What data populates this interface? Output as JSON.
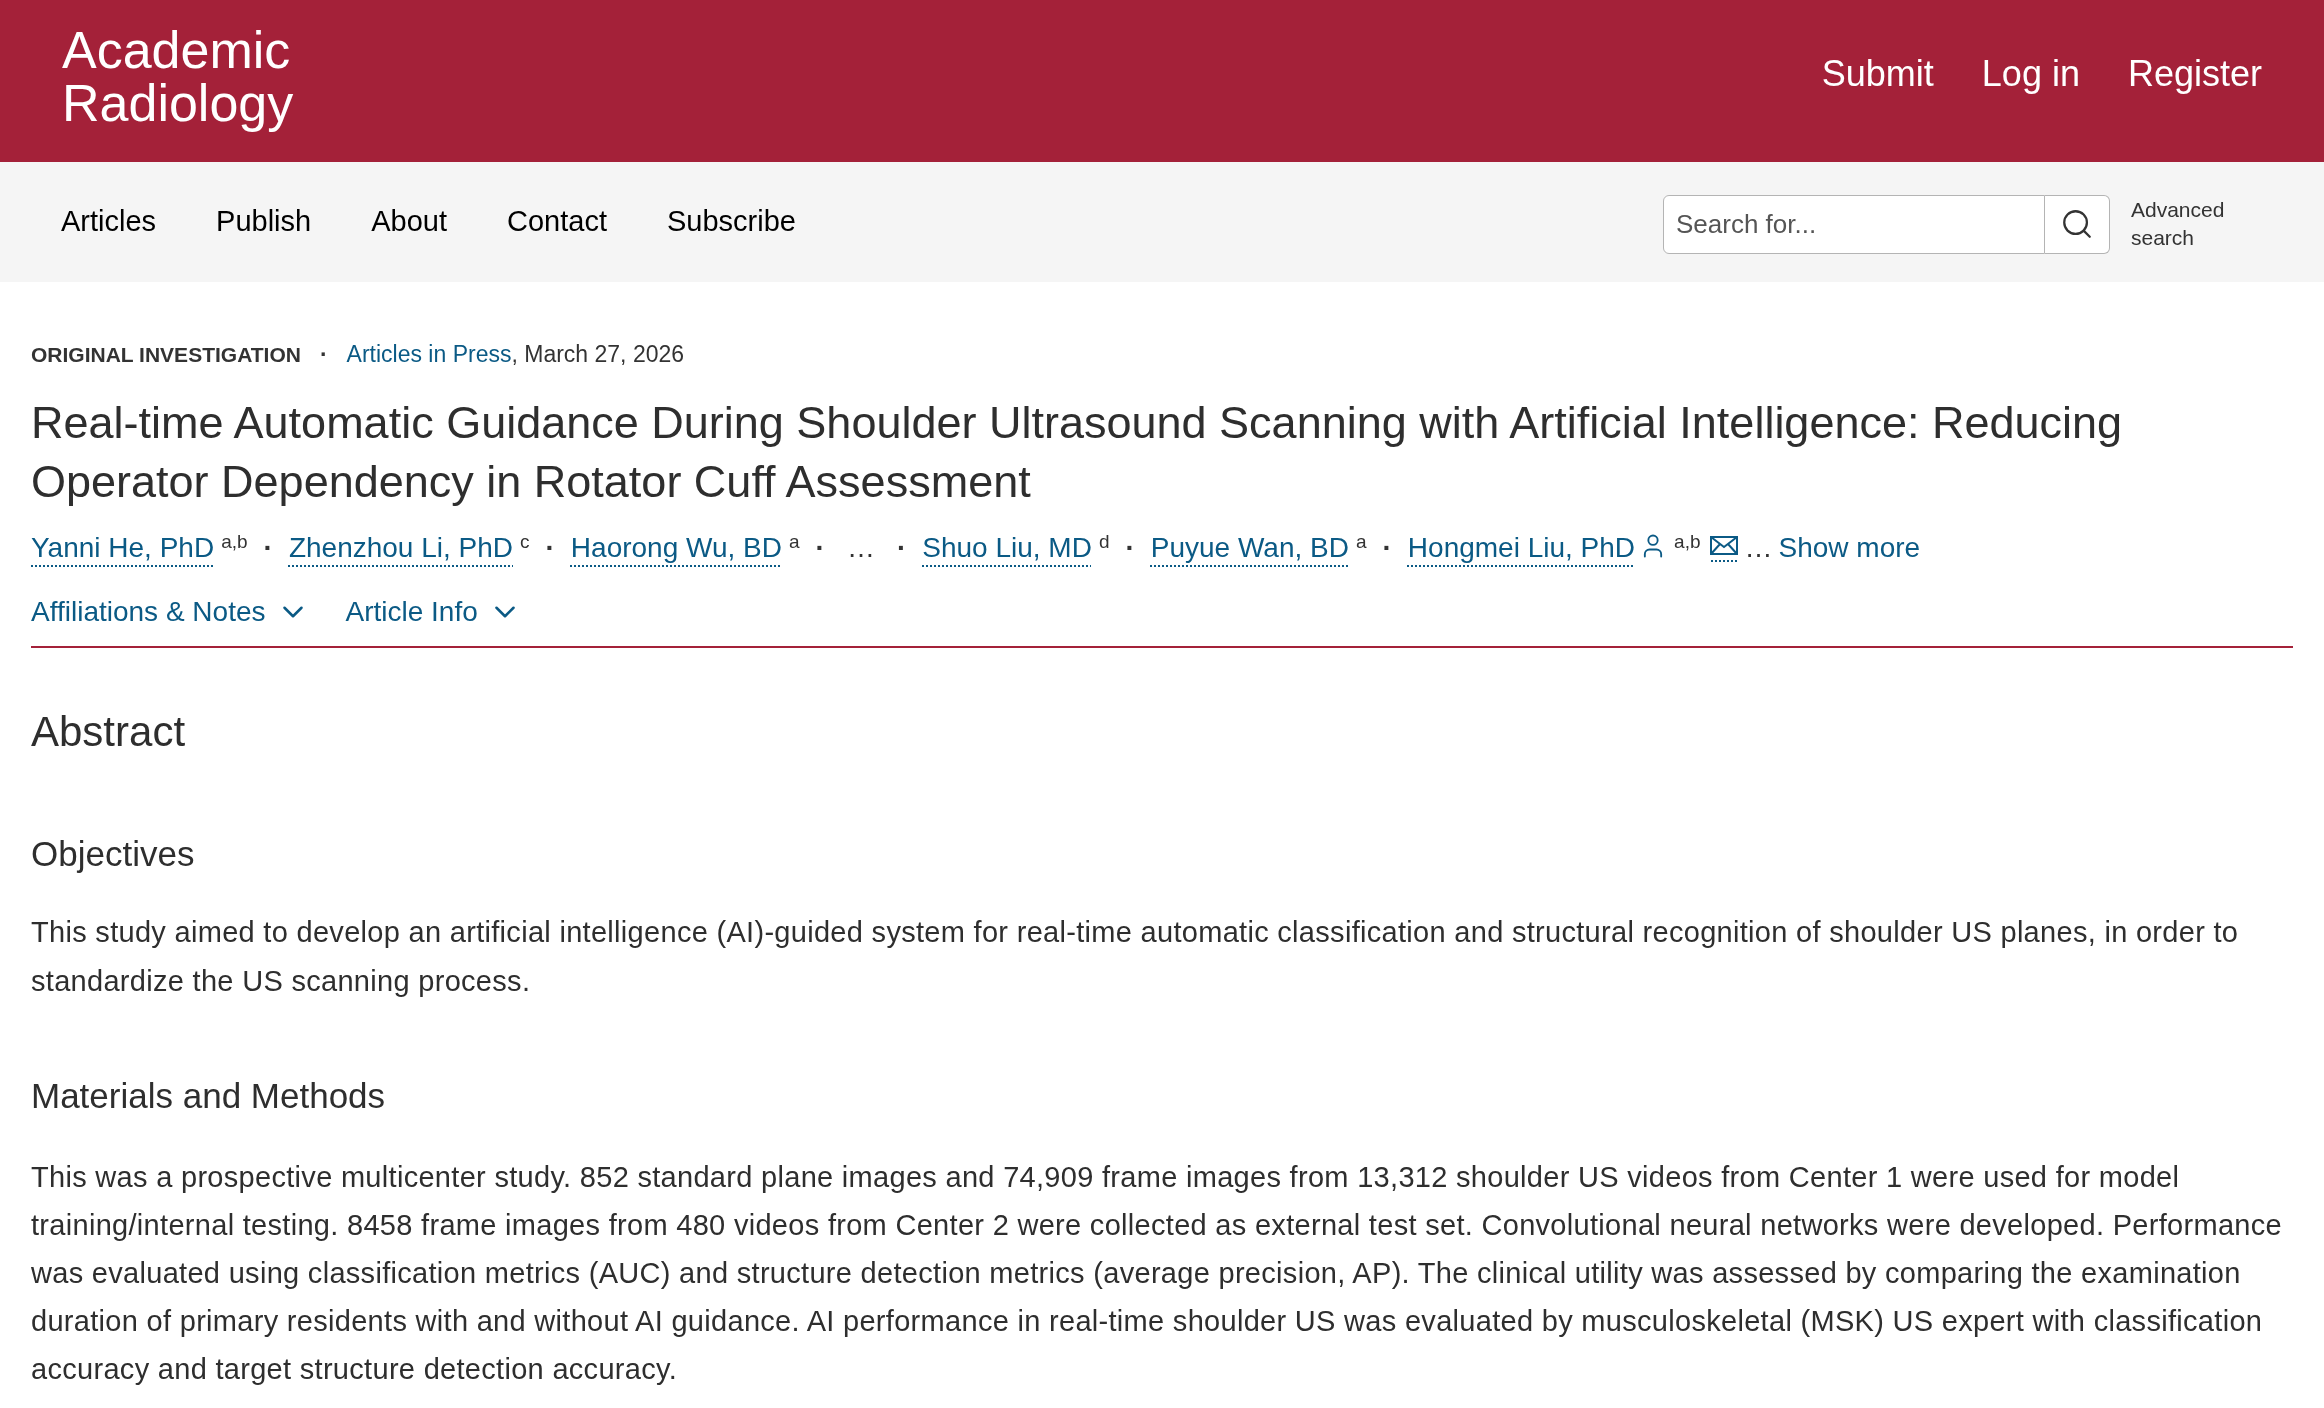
{
  "header": {
    "logo": "Academic Radiology",
    "links": [
      "Submit",
      "Log in",
      "Register"
    ]
  },
  "nav": {
    "items": [
      "Articles",
      "Publish",
      "About",
      "Contact",
      "Subscribe"
    ],
    "search": {
      "placeholder": "Search for..."
    },
    "advanced_search": "Advanced search"
  },
  "article": {
    "type": "ORIGINAL INVESTIGATION",
    "separator": "·",
    "section": "Articles in Press",
    "date": ", March 27, 2026",
    "title": "Real-time Automatic Guidance During Shoulder Ultrasound Scanning with Artificial Intelligence: Reducing Operator Dependency in Rotator Cuff Assessment",
    "authors": [
      {
        "kind": "author",
        "name": "Yanni He, PhD",
        "affiliations": "a,b",
        "corresponding": false,
        "email": false
      },
      {
        "kind": "separator",
        "text": "·"
      },
      {
        "kind": "author",
        "name": "Zhenzhou Li, PhD",
        "affiliations": "c",
        "corresponding": false,
        "email": false
      },
      {
        "kind": "separator",
        "text": "·"
      },
      {
        "kind": "author",
        "name": "Haorong Wu, BD",
        "affiliations": "a",
        "corresponding": false,
        "email": false
      },
      {
        "kind": "separator",
        "text": "·"
      },
      {
        "kind": "ellipsis",
        "text": "…"
      },
      {
        "kind": "separator",
        "text": "·"
      },
      {
        "kind": "author",
        "name": "Shuo Liu, MD",
        "affiliations": "d",
        "corresponding": false,
        "email": false
      },
      {
        "kind": "separator",
        "text": "·"
      },
      {
        "kind": "author",
        "name": "Puyue Wan, BD",
        "affiliations": "a",
        "corresponding": false,
        "email": false
      },
      {
        "kind": "separator",
        "text": "·"
      },
      {
        "kind": "author",
        "name": "Hongmei Liu, PhD",
        "affiliations": "a,b",
        "corresponding": true,
        "email": true
      },
      {
        "kind": "ellipsis",
        "text": "…"
      },
      {
        "kind": "link",
        "text": "Show more"
      }
    ],
    "toggles": [
      {
        "label": "Affiliations & Notes",
        "expanded": false
      },
      {
        "label": "Article Info",
        "expanded": false
      }
    ]
  },
  "abstract": {
    "heading": "Abstract",
    "sections": [
      {
        "heading": "Objectives",
        "text": "This study aimed to develop an artificial intelligence (AI)-guided system for real-time automatic classification and structural recognition of shoulder US planes, in order to standardize the US scanning process."
      },
      {
        "heading": "Materials and Methods",
        "text": "This was a prospective multicenter study. 852 standard plane images and 74,909 frame images from 13,312 shoulder US videos from Center 1 were used for model training/internal testing. 8458 frame images from 480 videos from Center 2 were collected as external test set. Convolutional neural networks were developed. Performance was evaluated using classification metrics (AUC) and structure detection metrics (average precision, AP). The clinical utility was assessed by comparing the examination duration of primary residents with and without AI guidance. AI performance in real-time shoulder US was evaluated by musculoskeletal (MSK) US expert with classification accuracy and target structure detection accuracy."
      }
    ]
  }
}
